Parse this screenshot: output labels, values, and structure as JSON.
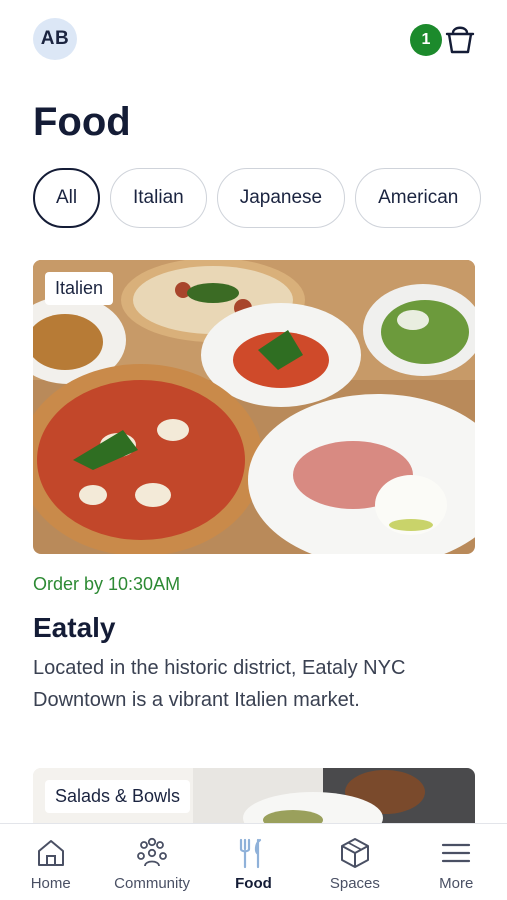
{
  "header": {
    "avatar_initials": "AB",
    "cart_count": "1",
    "cart_icon": "basket-icon"
  },
  "page": {
    "title": "Food"
  },
  "filters": [
    {
      "label": "All",
      "selected": true
    },
    {
      "label": "Italian",
      "selected": false
    },
    {
      "label": "Japanese",
      "selected": false
    },
    {
      "label": "American",
      "selected": false
    }
  ],
  "venues": [
    {
      "tag": "Italien",
      "order_by": "Order by 10:30AM",
      "name": "Eataly",
      "description": "Located in the historic district, Eataly NYC Downtown is a vibrant Italien market."
    },
    {
      "tag": "Salads & Bowls"
    }
  ],
  "tabbar": {
    "items": [
      {
        "label": "Home",
        "icon": "home-icon",
        "active": false
      },
      {
        "label": "Community",
        "icon": "community-icon",
        "active": false
      },
      {
        "label": "Food",
        "icon": "fork-knife-icon",
        "active": true
      },
      {
        "label": "Spaces",
        "icon": "cube-icon",
        "active": false
      },
      {
        "label": "More",
        "icon": "menu-icon",
        "active": false
      }
    ]
  },
  "colors": {
    "primary_text": "#141c36",
    "accent_green": "#1c8a2c",
    "avatar_bg": "#dce7f6",
    "active_tab_icon": "#8fb1d9"
  }
}
